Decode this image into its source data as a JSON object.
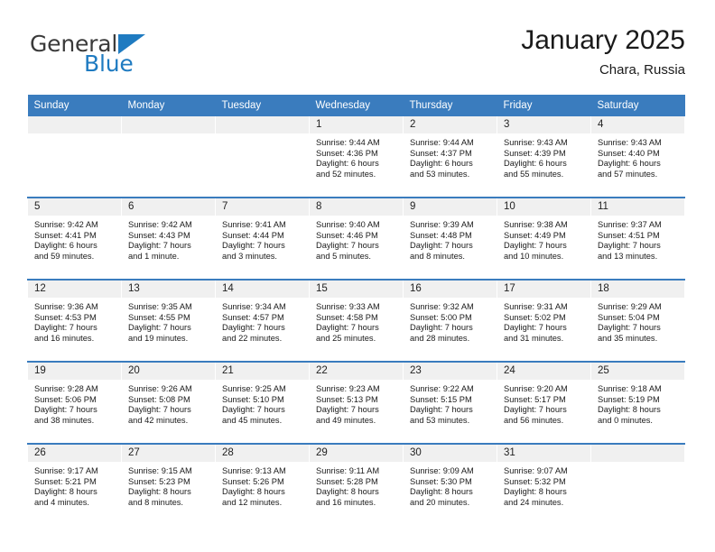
{
  "brand": {
    "name_part1": "General",
    "name_part2": "Blue",
    "accent_color": "#1f7bc1"
  },
  "header": {
    "title": "January 2025",
    "subtitle": "Chara, Russia"
  },
  "calendar": {
    "header_bg": "#3a7cbe",
    "daynum_bg": "#f0f0f0",
    "weekdays": [
      "Sunday",
      "Monday",
      "Tuesday",
      "Wednesday",
      "Thursday",
      "Friday",
      "Saturday"
    ],
    "weeks": [
      [
        {
          "day": "",
          "lines": []
        },
        {
          "day": "",
          "lines": []
        },
        {
          "day": "",
          "lines": []
        },
        {
          "day": "1",
          "lines": [
            "Sunrise: 9:44 AM",
            "Sunset: 4:36 PM",
            "Daylight: 6 hours",
            "and 52 minutes."
          ]
        },
        {
          "day": "2",
          "lines": [
            "Sunrise: 9:44 AM",
            "Sunset: 4:37 PM",
            "Daylight: 6 hours",
            "and 53 minutes."
          ]
        },
        {
          "day": "3",
          "lines": [
            "Sunrise: 9:43 AM",
            "Sunset: 4:39 PM",
            "Daylight: 6 hours",
            "and 55 minutes."
          ]
        },
        {
          "day": "4",
          "lines": [
            "Sunrise: 9:43 AM",
            "Sunset: 4:40 PM",
            "Daylight: 6 hours",
            "and 57 minutes."
          ]
        }
      ],
      [
        {
          "day": "5",
          "lines": [
            "Sunrise: 9:42 AM",
            "Sunset: 4:41 PM",
            "Daylight: 6 hours",
            "and 59 minutes."
          ]
        },
        {
          "day": "6",
          "lines": [
            "Sunrise: 9:42 AM",
            "Sunset: 4:43 PM",
            "Daylight: 7 hours",
            "and 1 minute."
          ]
        },
        {
          "day": "7",
          "lines": [
            "Sunrise: 9:41 AM",
            "Sunset: 4:44 PM",
            "Daylight: 7 hours",
            "and 3 minutes."
          ]
        },
        {
          "day": "8",
          "lines": [
            "Sunrise: 9:40 AM",
            "Sunset: 4:46 PM",
            "Daylight: 7 hours",
            "and 5 minutes."
          ]
        },
        {
          "day": "9",
          "lines": [
            "Sunrise: 9:39 AM",
            "Sunset: 4:48 PM",
            "Daylight: 7 hours",
            "and 8 minutes."
          ]
        },
        {
          "day": "10",
          "lines": [
            "Sunrise: 9:38 AM",
            "Sunset: 4:49 PM",
            "Daylight: 7 hours",
            "and 10 minutes."
          ]
        },
        {
          "day": "11",
          "lines": [
            "Sunrise: 9:37 AM",
            "Sunset: 4:51 PM",
            "Daylight: 7 hours",
            "and 13 minutes."
          ]
        }
      ],
      [
        {
          "day": "12",
          "lines": [
            "Sunrise: 9:36 AM",
            "Sunset: 4:53 PM",
            "Daylight: 7 hours",
            "and 16 minutes."
          ]
        },
        {
          "day": "13",
          "lines": [
            "Sunrise: 9:35 AM",
            "Sunset: 4:55 PM",
            "Daylight: 7 hours",
            "and 19 minutes."
          ]
        },
        {
          "day": "14",
          "lines": [
            "Sunrise: 9:34 AM",
            "Sunset: 4:57 PM",
            "Daylight: 7 hours",
            "and 22 minutes."
          ]
        },
        {
          "day": "15",
          "lines": [
            "Sunrise: 9:33 AM",
            "Sunset: 4:58 PM",
            "Daylight: 7 hours",
            "and 25 minutes."
          ]
        },
        {
          "day": "16",
          "lines": [
            "Sunrise: 9:32 AM",
            "Sunset: 5:00 PM",
            "Daylight: 7 hours",
            "and 28 minutes."
          ]
        },
        {
          "day": "17",
          "lines": [
            "Sunrise: 9:31 AM",
            "Sunset: 5:02 PM",
            "Daylight: 7 hours",
            "and 31 minutes."
          ]
        },
        {
          "day": "18",
          "lines": [
            "Sunrise: 9:29 AM",
            "Sunset: 5:04 PM",
            "Daylight: 7 hours",
            "and 35 minutes."
          ]
        }
      ],
      [
        {
          "day": "19",
          "lines": [
            "Sunrise: 9:28 AM",
            "Sunset: 5:06 PM",
            "Daylight: 7 hours",
            "and 38 minutes."
          ]
        },
        {
          "day": "20",
          "lines": [
            "Sunrise: 9:26 AM",
            "Sunset: 5:08 PM",
            "Daylight: 7 hours",
            "and 42 minutes."
          ]
        },
        {
          "day": "21",
          "lines": [
            "Sunrise: 9:25 AM",
            "Sunset: 5:10 PM",
            "Daylight: 7 hours",
            "and 45 minutes."
          ]
        },
        {
          "day": "22",
          "lines": [
            "Sunrise: 9:23 AM",
            "Sunset: 5:13 PM",
            "Daylight: 7 hours",
            "and 49 minutes."
          ]
        },
        {
          "day": "23",
          "lines": [
            "Sunrise: 9:22 AM",
            "Sunset: 5:15 PM",
            "Daylight: 7 hours",
            "and 53 minutes."
          ]
        },
        {
          "day": "24",
          "lines": [
            "Sunrise: 9:20 AM",
            "Sunset: 5:17 PM",
            "Daylight: 7 hours",
            "and 56 minutes."
          ]
        },
        {
          "day": "25",
          "lines": [
            "Sunrise: 9:18 AM",
            "Sunset: 5:19 PM",
            "Daylight: 8 hours",
            "and 0 minutes."
          ]
        }
      ],
      [
        {
          "day": "26",
          "lines": [
            "Sunrise: 9:17 AM",
            "Sunset: 5:21 PM",
            "Daylight: 8 hours",
            "and 4 minutes."
          ]
        },
        {
          "day": "27",
          "lines": [
            "Sunrise: 9:15 AM",
            "Sunset: 5:23 PM",
            "Daylight: 8 hours",
            "and 8 minutes."
          ]
        },
        {
          "day": "28",
          "lines": [
            "Sunrise: 9:13 AM",
            "Sunset: 5:26 PM",
            "Daylight: 8 hours",
            "and 12 minutes."
          ]
        },
        {
          "day": "29",
          "lines": [
            "Sunrise: 9:11 AM",
            "Sunset: 5:28 PM",
            "Daylight: 8 hours",
            "and 16 minutes."
          ]
        },
        {
          "day": "30",
          "lines": [
            "Sunrise: 9:09 AM",
            "Sunset: 5:30 PM",
            "Daylight: 8 hours",
            "and 20 minutes."
          ]
        },
        {
          "day": "31",
          "lines": [
            "Sunrise: 9:07 AM",
            "Sunset: 5:32 PM",
            "Daylight: 8 hours",
            "and 24 minutes."
          ]
        },
        {
          "day": "",
          "lines": []
        }
      ]
    ]
  }
}
